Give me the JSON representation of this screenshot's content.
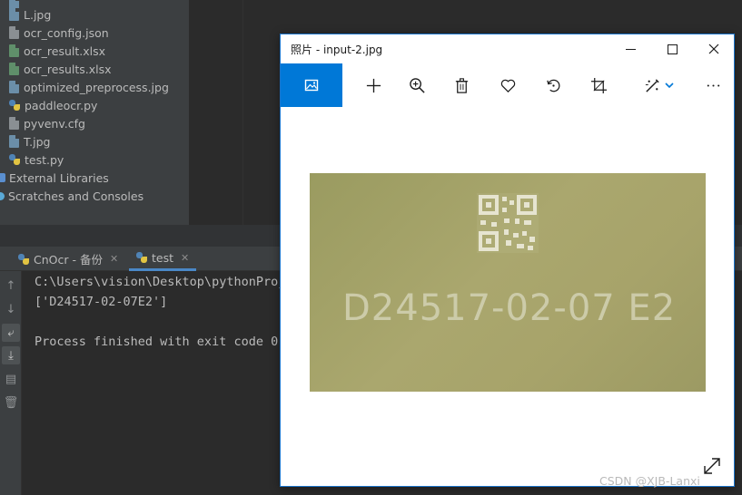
{
  "project_tree": {
    "files": [
      {
        "name": "L.jpg",
        "kind": "img"
      },
      {
        "name": "ocr_config.json",
        "kind": "json"
      },
      {
        "name": "ocr_result.xlsx",
        "kind": "xlsx"
      },
      {
        "name": "ocr_results.xlsx",
        "kind": "xlsx"
      },
      {
        "name": "optimized_preprocess.jpg",
        "kind": "img"
      },
      {
        "name": "paddleocr.py",
        "kind": "py"
      },
      {
        "name": "pyvenv.cfg",
        "kind": "cfg"
      },
      {
        "name": "T.jpg",
        "kind": "img"
      },
      {
        "name": "test.py",
        "kind": "py"
      }
    ],
    "external_libraries": "External Libraries",
    "scratches": "Scratches and Consoles"
  },
  "run_panel": {
    "tabs": [
      {
        "label": "CnOcr - 备份",
        "active": false
      },
      {
        "label": "test",
        "active": true
      }
    ],
    "console_lines": [
      "C:\\Users\\vision\\Desktop\\pythonProj",
      "['D24517-02-07E2']",
      "",
      "Process finished with exit code 0"
    ]
  },
  "photo_viewer": {
    "title": "照片 - input-2.jpg",
    "image_text": "D24517-02-07 E2",
    "accent_color": "#0078d7"
  },
  "watermark": "CSDN @XJB-Lanxi"
}
